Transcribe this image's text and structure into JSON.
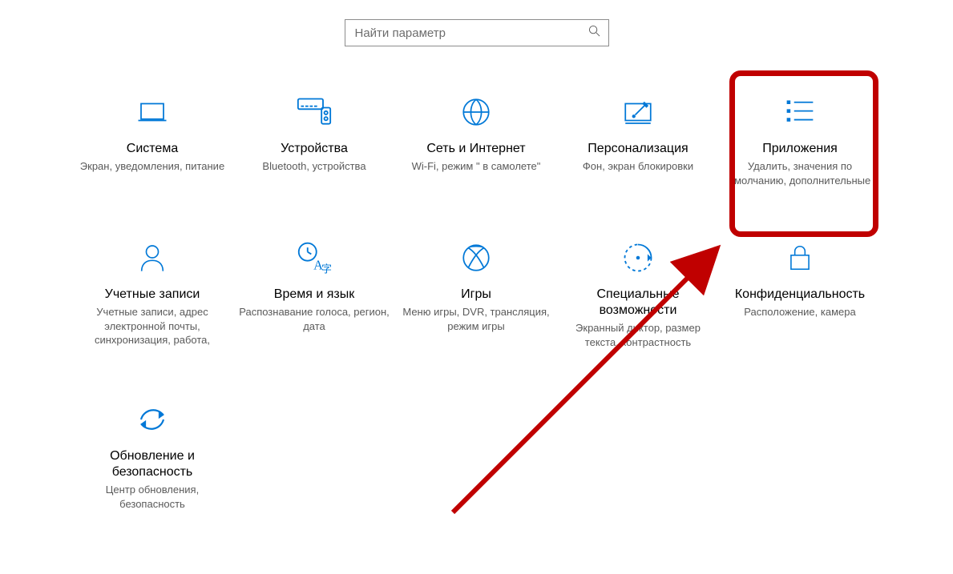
{
  "search": {
    "placeholder": "Найти параметр"
  },
  "tiles": [
    {
      "title": "Система",
      "desc": "Экран, уведомления, питание"
    },
    {
      "title": "Устройства",
      "desc": "Bluetooth, устройства"
    },
    {
      "title": "Сеть и Интернет",
      "desc": "Wi-Fi, режим \" в самолете\""
    },
    {
      "title": "Персонализация",
      "desc": "Фон, экран блокировки"
    },
    {
      "title": "Приложения",
      "desc": "Удалить, значения по умолчанию, дополнительные"
    },
    {
      "title": "Учетные записи",
      "desc": "Учетные записи, адрес электронной почты, синхронизация, работа,"
    },
    {
      "title": "Время и язык",
      "desc": "Распознавание голоса, регион, дата"
    },
    {
      "title": "Игры",
      "desc": "Меню игры, DVR, трансляция, режим игры"
    },
    {
      "title": "Специальные возможности",
      "desc": "Экранный диктор, размер текста, контрастность"
    },
    {
      "title": "Конфиденциальность",
      "desc": "Расположение, камера"
    },
    {
      "title": "Обновление и безопасность",
      "desc": "Центр обновления, безопасность"
    }
  ],
  "colors": {
    "accent": "#0078d7",
    "annotation": "#c00000"
  }
}
